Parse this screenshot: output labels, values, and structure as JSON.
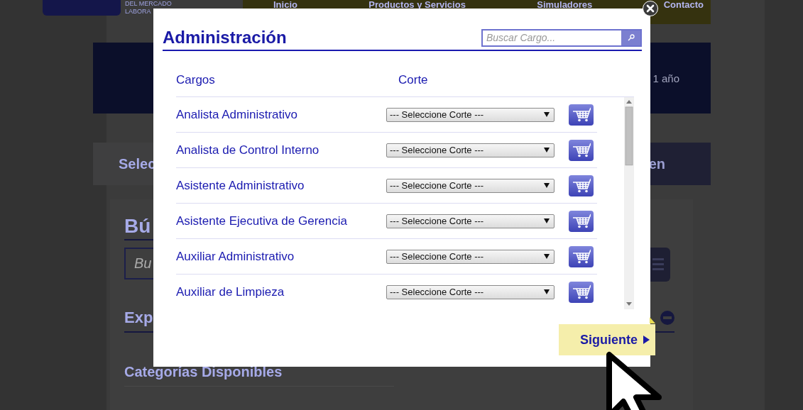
{
  "background_page": {
    "logo_text": [
      "DEL MERCADO",
      "LABORA"
    ],
    "nav": [
      {
        "label": "Inicio"
      },
      {
        "label": "Productos y Servicios"
      },
      {
        "label": "Simuladores"
      },
      {
        "label": "Contacto"
      }
    ],
    "banner_text": "1 año",
    "tab_fragments": [
      "Selec",
      "en"
    ],
    "search_heading": "Bú",
    "search_placeholder": "Bu",
    "explore_heading": "Exp",
    "categories_heading": "Categorías Disponibles"
  },
  "modal": {
    "title": "Administración",
    "search": {
      "placeholder": "Buscar Cargo..."
    },
    "columns": [
      "Cargos",
      "Corte"
    ],
    "rows": [
      {
        "name": "Analista Administrativo",
        "corte": "--- Seleccione Corte ---"
      },
      {
        "name": "Analista de Control Interno",
        "corte": "--- Seleccione Corte ---"
      },
      {
        "name": "Asistente Administrativo",
        "corte": "--- Seleccione Corte ---"
      },
      {
        "name": "Asistente Ejecutiva de Gerencia",
        "corte": "--- Seleccione Corte ---"
      },
      {
        "name": "Auxiliar Administrativo",
        "corte": "--- Seleccione Corte ---"
      },
      {
        "name": "Auxiliar de Limpieza",
        "corte": "--- Seleccione Corte ---"
      }
    ],
    "next_button": "Siguiente"
  }
}
